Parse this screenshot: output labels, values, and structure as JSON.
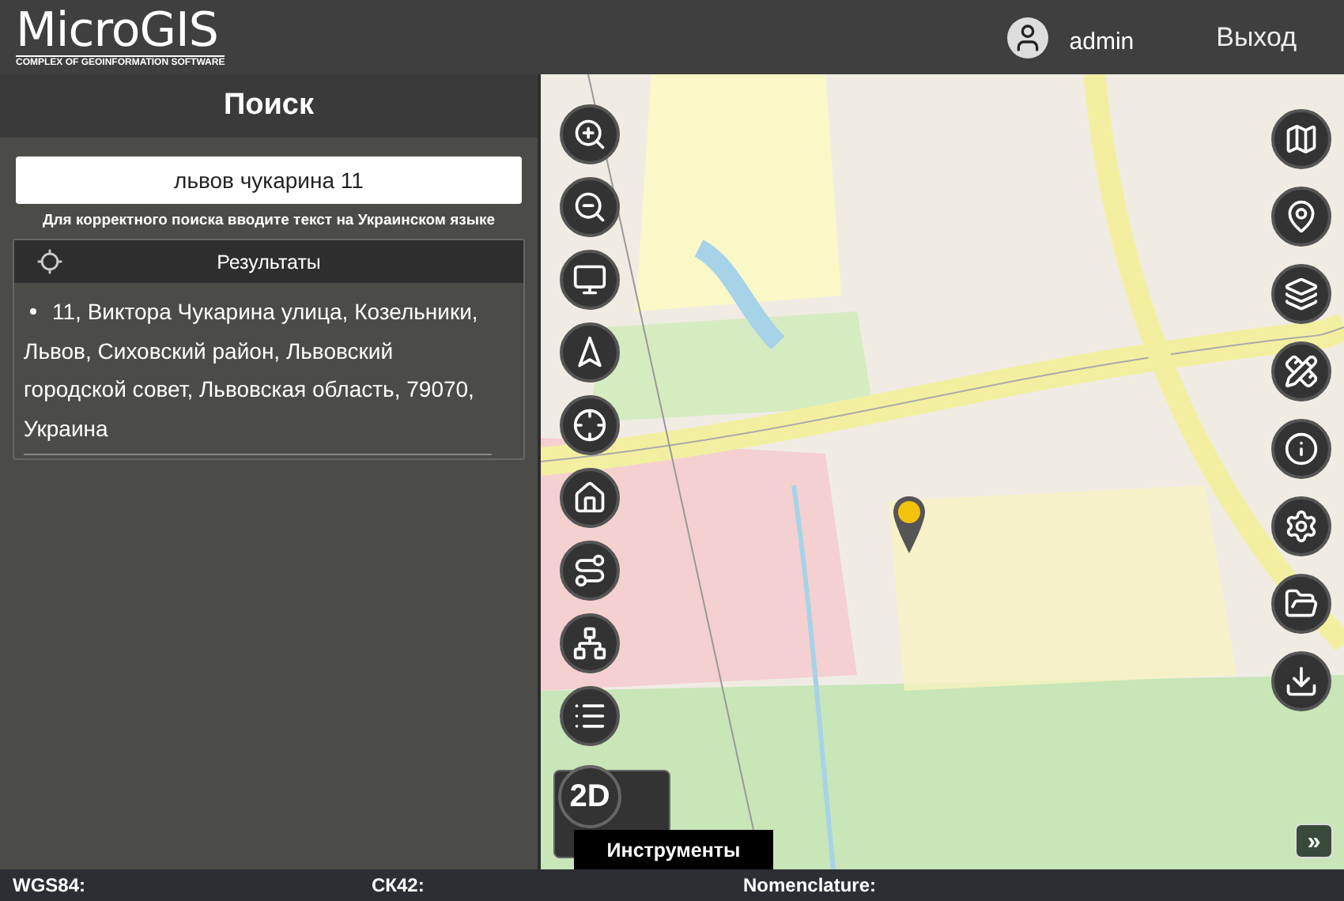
{
  "header": {
    "logo_title": "MicroGIS",
    "logo_subtitle": "COMPLEX OF GEOINFORMATION SOFTWARE",
    "user": "admin",
    "logout": "Выход"
  },
  "search_panel": {
    "title": "Поиск",
    "search": {
      "value": "львов чукарина 11"
    },
    "hint": "Для корректного поиска вводите текст на Украинском языке",
    "results_title": "Результаты",
    "results": [
      "11, Виктора Чукарина улица, Козельники, Львов, Сиховский район, Львовский городской совет, Львовская область, 79070, Украина"
    ]
  },
  "map": {
    "mode_button": "2D",
    "tools_tab": "Инструменты",
    "expand_button": "»"
  },
  "status_bar": [
    {
      "label": "WGS84:"
    },
    {
      "label": "СК42:"
    },
    {
      "label": "Nomenclature:"
    }
  ]
}
